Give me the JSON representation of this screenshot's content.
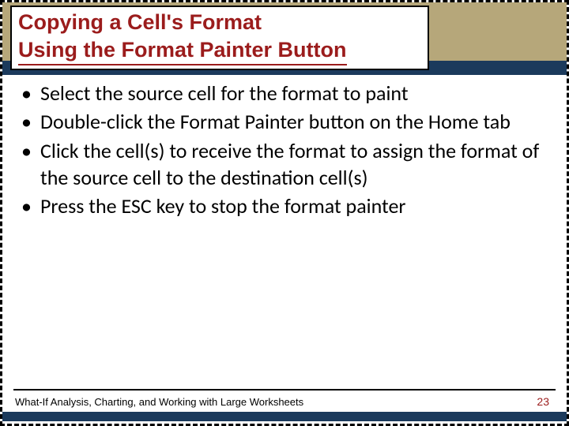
{
  "title": {
    "line1": "Copying a Cell's Format",
    "line2": "Using the Format Painter Button"
  },
  "bullets": [
    "Select the source cell for the format to paint",
    "Double-click the Format Painter button on the Home tab",
    "Click the cell(s) to receive the format to assign the format of the source cell to the destination cell(s)",
    "Press the ESC key to stop the format painter"
  ],
  "footer": {
    "text": "What-If Analysis, Charting, and Working with Large Worksheets",
    "page": "23"
  }
}
